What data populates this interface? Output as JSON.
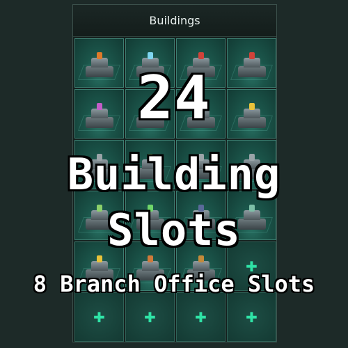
{
  "panel": {
    "title": "Buildings"
  },
  "slots": [
    {
      "filled": true,
      "accent": "#e07a2a"
    },
    {
      "filled": true,
      "accent": "#7fd6f0"
    },
    {
      "filled": true,
      "accent": "#d0433a"
    },
    {
      "filled": true,
      "accent": "#d0433a"
    },
    {
      "filled": true,
      "accent": "#c45cc8"
    },
    {
      "filled": true,
      "accent": "#c45cc8"
    },
    {
      "filled": true,
      "accent": "#9aa4a8"
    },
    {
      "filled": true,
      "accent": "#e8c23a"
    },
    {
      "filled": true,
      "accent": "#9aa4a8"
    },
    {
      "filled": true,
      "accent": "#8cd06a"
    },
    {
      "filled": true,
      "accent": "#9aa4a8"
    },
    {
      "filled": true,
      "accent": "#9aa4a8"
    },
    {
      "filled": true,
      "accent": "#8cd06a"
    },
    {
      "filled": true,
      "accent": "#6fd66a"
    },
    {
      "filled": true,
      "accent": "#5a6a9a"
    },
    {
      "filled": true,
      "accent": "#7ec0a8"
    },
    {
      "filled": true,
      "accent": "#e8c23a"
    },
    {
      "filled": true,
      "accent": "#d07a3a"
    },
    {
      "filled": true,
      "accent": "#c48a3a"
    },
    {
      "filled": false
    },
    {
      "filled": false
    },
    {
      "filled": false
    },
    {
      "filled": false
    },
    {
      "filled": false
    }
  ],
  "overlay": {
    "count": "24",
    "line1": "Building",
    "line2": "Slots",
    "subtitle": "8 Branch Office Slots"
  },
  "colors": {
    "plus": "#2fe3a6",
    "slot_border": "#3d7e71",
    "background": "#1d2a28"
  }
}
